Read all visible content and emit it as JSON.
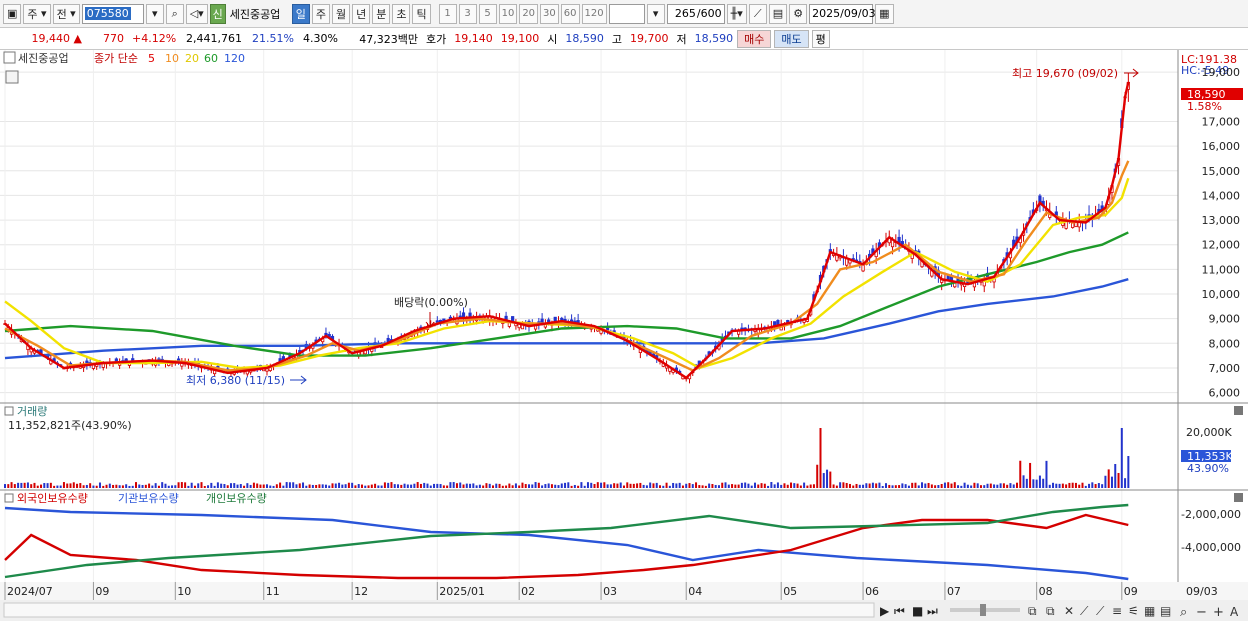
{
  "toolbar": {
    "market": "주",
    "range": "전",
    "code": "075580",
    "stock_name": "세진중공업",
    "new_badge": "신",
    "periods": [
      "일",
      "주",
      "월",
      "년",
      "분",
      "초",
      "틱"
    ],
    "minute_options": [
      "1",
      "3",
      "5",
      "10",
      "20",
      "30",
      "60",
      "120"
    ],
    "count": "265",
    "count_max": "/600",
    "date": "2025/09/03"
  },
  "quote": {
    "price": "19,440",
    "arrow": "▲",
    "change": "770",
    "change_pct": "+4.12%",
    "volume": "2,441,761",
    "turnover_pct": "21.51%",
    "value_pct": "4.30%",
    "amount": "47,323백만",
    "bid_label": "호가",
    "bid": "19,140",
    "ask": "19,100",
    "open_label": "시",
    "open": "18,590",
    "high_label": "고",
    "high": "19,700",
    "low_label": "저",
    "low": "18,590",
    "buy": "매수",
    "sell": "매도",
    "avg": "평"
  },
  "price_panel": {
    "legend_name": "세진중공업",
    "legend_label": "종가 단순",
    "ma": [
      {
        "period": "5",
        "color": "#e00000"
      },
      {
        "period": "10",
        "color": "#f08c1e"
      },
      {
        "period": "20",
        "color": "#f2e200"
      },
      {
        "period": "60",
        "color": "#1e9a2a"
      },
      {
        "period": "120",
        "color": "#2a55d8"
      }
    ],
    "lc": "LC:191.38",
    "hc": "HC:-5.49",
    "max_note": "최고 19,670 (09/02)",
    "min_note": "최저 6,380 (11/15)",
    "dividend_note": "배당락(0.00%)",
    "current_price": "18,590",
    "current_pct": "1.58%"
  },
  "volume_panel": {
    "title": "거래량",
    "value": "11,352,821주(43.90%)",
    "current": "11,353K",
    "current_pct": "43.90%",
    "axis": [
      "20,000K",
      "10,000K"
    ]
  },
  "holding_panel": {
    "series": [
      "외국인보유수량",
      "기관보유수량",
      "개인보유수량"
    ],
    "axis": [
      "-2,000,000",
      "-4,000,000"
    ]
  },
  "x_labels": [
    "2024/07",
    "09",
    "10",
    "11",
    "12",
    "2025/01",
    "02",
    "03",
    "04",
    "05",
    "06",
    "07",
    "08",
    "09"
  ],
  "x_right": "09/03",
  "chart_data": {
    "type": "line",
    "y_ticks": [
      19000,
      17000,
      16000,
      15000,
      14000,
      13000,
      12000,
      11000,
      10000,
      9000,
      8000,
      7000,
      6000
    ],
    "ylim": [
      5700,
      19900
    ],
    "x_label_positions": [
      0,
      27,
      52,
      79,
      106,
      132,
      157,
      182,
      208,
      237,
      262,
      287,
      315,
      341
    ],
    "x_count": 350,
    "series": [
      {
        "name": "5",
        "color": "#e00000",
        "points": [
          [
            0,
            8800
          ],
          [
            8,
            7800
          ],
          [
            18,
            7000
          ],
          [
            30,
            7200
          ],
          [
            45,
            7300
          ],
          [
            55,
            7200
          ],
          [
            68,
            6800
          ],
          [
            80,
            7000
          ],
          [
            90,
            7600
          ],
          [
            98,
            8300
          ],
          [
            106,
            7600
          ],
          [
            115,
            7900
          ],
          [
            125,
            8500
          ],
          [
            137,
            9000
          ],
          [
            148,
            9100
          ],
          [
            160,
            8700
          ],
          [
            170,
            8900
          ],
          [
            180,
            8700
          ],
          [
            190,
            8100
          ],
          [
            200,
            7300
          ],
          [
            208,
            6600
          ],
          [
            215,
            7500
          ],
          [
            222,
            8500
          ],
          [
            232,
            8600
          ],
          [
            245,
            9000
          ],
          [
            249,
            10500
          ],
          [
            252,
            11700
          ],
          [
            262,
            11200
          ],
          [
            270,
            12300
          ],
          [
            278,
            11600
          ],
          [
            286,
            10600
          ],
          [
            294,
            10400
          ],
          [
            302,
            10700
          ],
          [
            310,
            12300
          ],
          [
            316,
            13700
          ],
          [
            322,
            13000
          ],
          [
            330,
            12900
          ],
          [
            336,
            13500
          ],
          [
            338,
            14400
          ],
          [
            340,
            15500
          ],
          [
            342,
            18000
          ],
          [
            343,
            18590
          ]
        ]
      },
      {
        "name": "10",
        "color": "#f08c1e",
        "points": [
          [
            0,
            8600
          ],
          [
            10,
            7900
          ],
          [
            20,
            7100
          ],
          [
            30,
            7200
          ],
          [
            45,
            7300
          ],
          [
            55,
            7250
          ],
          [
            68,
            6900
          ],
          [
            80,
            7000
          ],
          [
            92,
            7500
          ],
          [
            100,
            8000
          ],
          [
            108,
            7700
          ],
          [
            120,
            8100
          ],
          [
            132,
            8800
          ],
          [
            145,
            9000
          ],
          [
            158,
            8800
          ],
          [
            170,
            8800
          ],
          [
            182,
            8600
          ],
          [
            192,
            8000
          ],
          [
            202,
            7400
          ],
          [
            210,
            6900
          ],
          [
            218,
            7400
          ],
          [
            228,
            8300
          ],
          [
            240,
            8800
          ],
          [
            248,
            9600
          ],
          [
            255,
            11000
          ],
          [
            265,
            11300
          ],
          [
            275,
            12000
          ],
          [
            285,
            10900
          ],
          [
            295,
            10500
          ],
          [
            305,
            10800
          ],
          [
            312,
            12200
          ],
          [
            318,
            13300
          ],
          [
            326,
            12900
          ],
          [
            334,
            13100
          ],
          [
            338,
            13700
          ],
          [
            341,
            14800
          ],
          [
            343,
            15400
          ]
        ]
      },
      {
        "name": "20",
        "color": "#f2e200",
        "points": [
          [
            0,
            9700
          ],
          [
            8,
            8900
          ],
          [
            18,
            7800
          ],
          [
            30,
            7200
          ],
          [
            45,
            7200
          ],
          [
            60,
            7250
          ],
          [
            72,
            7000
          ],
          [
            84,
            7100
          ],
          [
            96,
            7500
          ],
          [
            108,
            7800
          ],
          [
            120,
            8000
          ],
          [
            134,
            8600
          ],
          [
            148,
            8900
          ],
          [
            162,
            8800
          ],
          [
            178,
            8700
          ],
          [
            192,
            8200
          ],
          [
            204,
            7600
          ],
          [
            212,
            7000
          ],
          [
            222,
            7400
          ],
          [
            234,
            8200
          ],
          [
            246,
            8800
          ],
          [
            256,
            9900
          ],
          [
            268,
            10900
          ],
          [
            278,
            11700
          ],
          [
            290,
            10900
          ],
          [
            300,
            10500
          ],
          [
            310,
            11200
          ],
          [
            320,
            12800
          ],
          [
            328,
            13100
          ],
          [
            336,
            13200
          ],
          [
            341,
            13900
          ],
          [
            343,
            14700
          ]
        ]
      },
      {
        "name": "60",
        "color": "#1e9a2a",
        "points": [
          [
            0,
            8500
          ],
          [
            20,
            8700
          ],
          [
            45,
            8500
          ],
          [
            70,
            7900
          ],
          [
            90,
            7500
          ],
          [
            110,
            7500
          ],
          [
            130,
            7800
          ],
          [
            150,
            8200
          ],
          [
            170,
            8600
          ],
          [
            190,
            8700
          ],
          [
            205,
            8600
          ],
          [
            220,
            8200
          ],
          [
            240,
            8200
          ],
          [
            255,
            8700
          ],
          [
            270,
            9500
          ],
          [
            285,
            10300
          ],
          [
            300,
            10800
          ],
          [
            315,
            11300
          ],
          [
            325,
            11700
          ],
          [
            335,
            12000
          ],
          [
            343,
            12500
          ]
        ]
      },
      {
        "name": "120",
        "color": "#2a55d8",
        "points": [
          [
            0,
            7400
          ],
          [
            30,
            7700
          ],
          [
            60,
            7900
          ],
          [
            90,
            7900
          ],
          [
            120,
            8000
          ],
          [
            150,
            8000
          ],
          [
            180,
            8000
          ],
          [
            210,
            8000
          ],
          [
            230,
            8000
          ],
          [
            250,
            8200
          ],
          [
            270,
            8800
          ],
          [
            285,
            9300
          ],
          [
            300,
            9600
          ],
          [
            320,
            9900
          ],
          [
            335,
            10300
          ],
          [
            343,
            10600
          ]
        ]
      }
    ]
  }
}
